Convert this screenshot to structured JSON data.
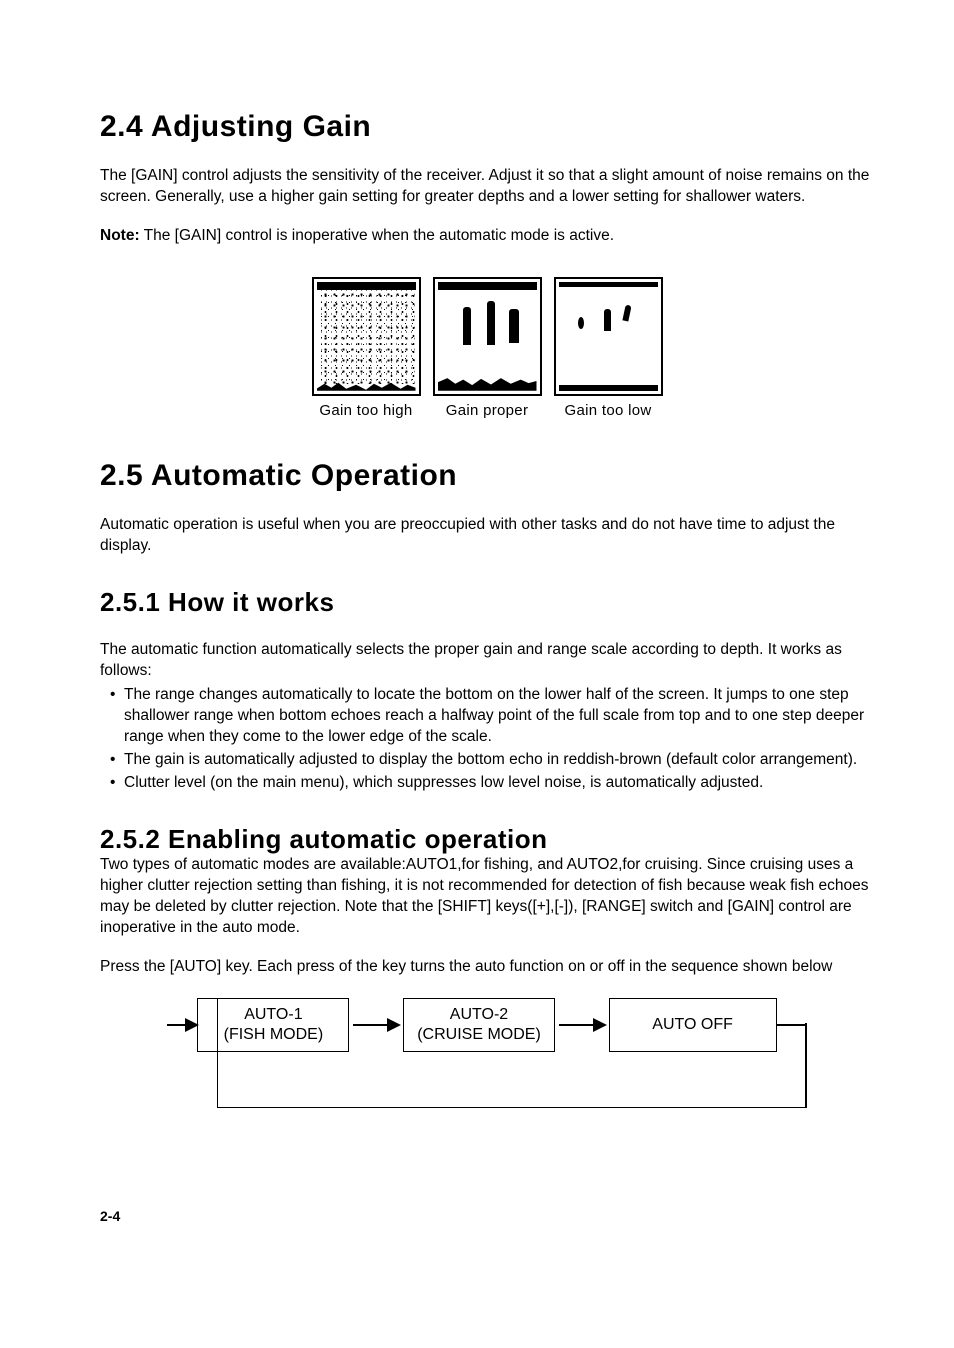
{
  "section_2_4": {
    "heading": "2.4  Adjusting Gain",
    "para1": "The [GAIN] control adjusts the sensitivity of the receiver. Adjust it so that a slight amount of noise remains on the screen. Generally, use a higher gain setting for greater depths and a lower setting for shallower waters.",
    "note_label": "Note:",
    "note_text": " The [GAIN] control is inoperative when the automatic mode is active.",
    "captions": {
      "high": "Gain too high",
      "proper": "Gain proper",
      "low": "Gain too low"
    }
  },
  "section_2_5": {
    "heading": "2.5  Automatic Operation",
    "para1": "Automatic operation is useful when you are preoccupied with other tasks and do not have time to adjust the display."
  },
  "section_2_5_1": {
    "heading": "2.5.1   How it works",
    "para1": "The automatic function automatically selects the proper gain and range scale according to depth. It works as follows:",
    "bullets": [
      "The range changes automatically to locate the bottom on the lower half of the screen. It jumps to one step shallower range when bottom echoes reach a halfway point of the full scale from top and to one step deeper range when they come to the lower edge of the scale.",
      "The gain is automatically adjusted to display the bottom echo in reddish-brown (default color arrangement).",
      "Clutter level (on the main menu), which suppresses low level noise, is automatically adjusted."
    ]
  },
  "section_2_5_2": {
    "heading": "2.5.2   Enabling automatic operation",
    "para1": "Two types of automatic modes are available:AUTO1,for fishing, and AUTO2,for cruising. Since cruising uses a higher clutter rejection setting than fishing, it is not recommended for detection of fish because weak fish echoes may be deleted by clutter rejection. Note that the [SHIFT] keys([+],[-]), [RANGE] switch and [GAIN] control are inoperative in the auto mode.",
    "para2": "Press the [AUTO] key. Each press of the key turns the auto function on or off in the sequence shown below",
    "flow": {
      "box1_line1": "AUTO-1",
      "box1_line2": "(FISH MODE)",
      "box2_line1": "AUTO-2",
      "box2_line2": "(CRUISE MODE)",
      "box3": "AUTO OFF"
    }
  },
  "page_number": "2-4"
}
